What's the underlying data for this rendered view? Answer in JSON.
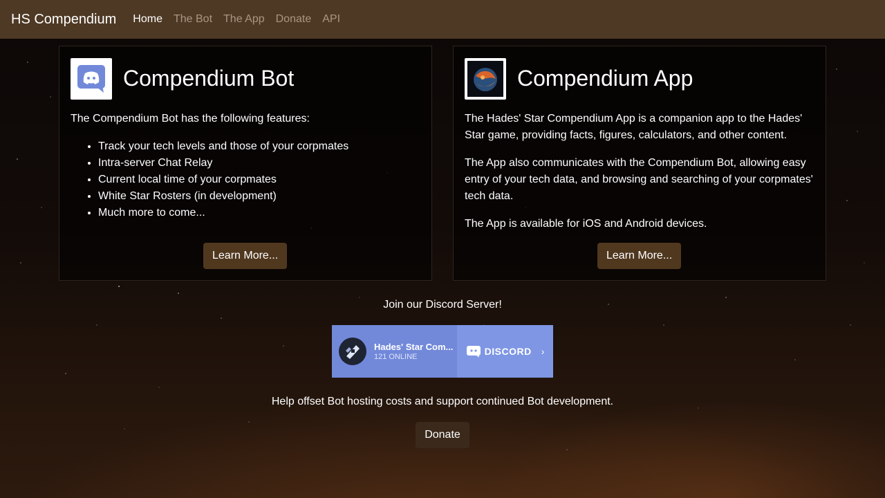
{
  "navbar": {
    "brand": "HS Compendium",
    "links": [
      {
        "label": "Home"
      },
      {
        "label": "The Bot"
      },
      {
        "label": "The App"
      },
      {
        "label": "Donate"
      },
      {
        "label": "API"
      }
    ]
  },
  "bot_card": {
    "title": "Compendium Bot",
    "intro": "The Compendium Bot has the following features:",
    "features": [
      "Track your tech levels and those of your corpmates",
      "Intra-server Chat Relay",
      "Current local time of your corpmates",
      "White Star Rosters (in development)",
      "Much more to come..."
    ],
    "button": "Learn More..."
  },
  "app_card": {
    "title": "Compendium App",
    "paragraphs": [
      "The Hades' Star Compendium App is a companion app to the Hades' Star game, providing facts, figures, calculators, and other content.",
      "The App also communicates with the Compendium Bot, allowing easy entry of your tech data, and browsing and searching of your corpmates' tech data.",
      "The App is available for iOS and Android devices."
    ],
    "button": "Learn More..."
  },
  "discord": {
    "join_text": "Join our Discord Server!",
    "widget": {
      "server_name": "Hades' Star Com...",
      "online": "121 ONLINE",
      "brand": "DISCORD"
    }
  },
  "donate": {
    "text": "Help offset Bot hosting costs and support continued Bot development.",
    "button": "Donate"
  },
  "colors": {
    "navbar": "#4e3924",
    "button": "#50381f",
    "discord_blurple": "#7289da"
  }
}
